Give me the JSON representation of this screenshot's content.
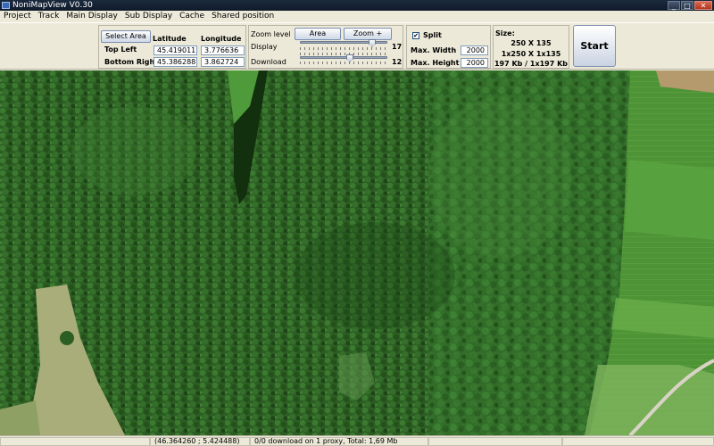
{
  "window": {
    "title": "NoniMapView V0.30",
    "min_glyph": "_",
    "max_glyph": "□",
    "close_glyph": "✕"
  },
  "menu": [
    "Project",
    "Track",
    "Main Display",
    "Sub Display",
    "Cache",
    "Shared position"
  ],
  "area": {
    "select_button": "Select Area",
    "latitude_header": "Latitude",
    "longitude_header": "Longitude",
    "top_left_label": "Top Left",
    "bottom_right_label": "Bottom Right",
    "top_left_lat": "45.419011",
    "top_left_lon": "3.776636",
    "bottom_right_lat": "45.386288",
    "bottom_right_lon": "3.862724"
  },
  "zoom": {
    "label": "Zoom level",
    "area_button": "Area",
    "zoom_plus_button": "Zoom +",
    "display_label": "Display",
    "display_value": "17",
    "download_label": "Download",
    "download_value": "12",
    "display_level_fraction": 0.85,
    "download_level_fraction": 0.58
  },
  "split": {
    "label": "Split",
    "checked": true,
    "check_glyph": "✔",
    "max_width_label": "Max. Width",
    "max_width_value": "2000",
    "max_height_label": "Max. Height",
    "max_height_value": "2000"
  },
  "size": {
    "label": "Size:",
    "line1": "250 X 135",
    "line2": "1x250 X 1x135",
    "line3": "197 Kb / 1x197 Kb"
  },
  "start_button": "Start",
  "status": {
    "coords": "(46.364260 ; 5.424488)",
    "download": "0/0 download on 1 proxy, Total: 1,69 Mb"
  },
  "colors": {
    "forest_dark": "#1f4a1a",
    "forest_mid": "#2f6a27",
    "forest_light": "#3f7f35",
    "field_green": "#5a9a3e",
    "field_light": "#8fb86a",
    "field_dry": "#b9b48a",
    "road": "#d8d2c4"
  }
}
